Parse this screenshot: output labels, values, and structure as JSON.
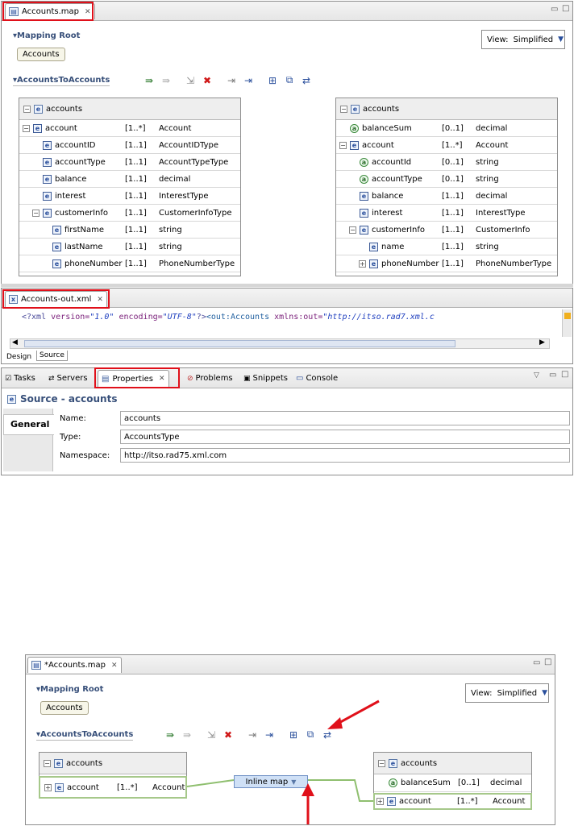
{
  "top_editor": {
    "tab_title": "Accounts.map",
    "mapping_root_label": "Mapping Root",
    "root_pill": "Accounts",
    "view_label": "View:",
    "view_value": "Simplified",
    "map_section": "AccountsToAccounts",
    "source": {
      "header": "accounts",
      "rows": [
        {
          "name": "account",
          "card": "[1..*]",
          "type": "Account",
          "indent": 0,
          "exp": "−",
          "icon": "e"
        },
        {
          "name": "accountID",
          "card": "[1..1]",
          "type": "AccountIDType",
          "indent": 1,
          "exp": "",
          "icon": "e"
        },
        {
          "name": "accountType",
          "card": "[1..1]",
          "type": "AccountTypeType",
          "indent": 1,
          "exp": "",
          "icon": "e"
        },
        {
          "name": "balance",
          "card": "[1..1]",
          "type": "decimal",
          "indent": 1,
          "exp": "",
          "icon": "e"
        },
        {
          "name": "interest",
          "card": "[1..1]",
          "type": "InterestType",
          "indent": 1,
          "exp": "",
          "icon": "e"
        },
        {
          "name": "customerInfo",
          "card": "[1..1]",
          "type": "CustomerInfoType",
          "indent": 1,
          "exp": "−",
          "icon": "e"
        },
        {
          "name": "firstName",
          "card": "[1..1]",
          "type": "string",
          "indent": 2,
          "exp": "",
          "icon": "e"
        },
        {
          "name": "lastName",
          "card": "[1..1]",
          "type": "string",
          "indent": 2,
          "exp": "",
          "icon": "e"
        },
        {
          "name": "phoneNumber",
          "card": "[1..1]",
          "type": "PhoneNumberType",
          "indent": 2,
          "exp": "",
          "icon": "e"
        }
      ]
    },
    "target": {
      "header": "accounts",
      "rows": [
        {
          "name": "balanceSum",
          "card": "[0..1]",
          "type": "decimal",
          "indent": 0,
          "exp": "",
          "icon": "a"
        },
        {
          "name": "account",
          "card": "[1..*]",
          "type": "Account",
          "indent": 0,
          "exp": "−",
          "icon": "e"
        },
        {
          "name": "accountId",
          "card": "[0..1]",
          "type": "string",
          "indent": 1,
          "exp": "",
          "icon": "a"
        },
        {
          "name": "accountType",
          "card": "[0..1]",
          "type": "string",
          "indent": 1,
          "exp": "",
          "icon": "a"
        },
        {
          "name": "balance",
          "card": "[1..1]",
          "type": "decimal",
          "indent": 1,
          "exp": "",
          "icon": "e"
        },
        {
          "name": "interest",
          "card": "[1..1]",
          "type": "InterestType",
          "indent": 1,
          "exp": "",
          "icon": "e"
        },
        {
          "name": "customerInfo",
          "card": "[1..1]",
          "type": "CustomerInfo",
          "indent": 1,
          "exp": "−",
          "icon": "e"
        },
        {
          "name": "name",
          "card": "[1..1]",
          "type": "string",
          "indent": 2,
          "exp": "",
          "icon": "e"
        },
        {
          "name": "phoneNumber",
          "card": "[1..1]",
          "type": "PhoneNumberType",
          "indent": 2,
          "exp": "+",
          "icon": "e"
        }
      ]
    }
  },
  "xml_editor": {
    "tab_title": "Accounts-out.xml",
    "decl_open": "<?xml",
    "version_attr": "version=",
    "version_val": "\"1.0\"",
    "enc_attr": "encoding=",
    "enc_val": "\"UTF-8\"",
    "decl_close": "?>",
    "elem": "<out:Accounts",
    "ns_attr": "xmlns:out=",
    "ns_val": "\"http://itso.rad7.xml.c",
    "tab_design": "Design",
    "tab_source": "Source"
  },
  "bottom_panel": {
    "tabs": [
      "Tasks",
      "Servers",
      "Properties",
      "Problems",
      "Snippets",
      "Console"
    ],
    "title": "Source - accounts",
    "side_tab": "General",
    "fields": [
      {
        "label": "Name:",
        "value": "accounts"
      },
      {
        "label": "Type:",
        "value": "AccountsType"
      },
      {
        "label": "Namespace:",
        "value": "http://itso.rad75.xml.com"
      }
    ]
  },
  "lower_editor": {
    "tab_title": "*Accounts.map",
    "mapping_root_label": "Mapping Root",
    "root_pill": "Accounts",
    "view_label": "View:",
    "view_value": "Simplified",
    "map_section": "AccountsToAccounts",
    "source": {
      "header": "accounts",
      "row": {
        "name": "account",
        "card": "[1..*]",
        "type": "Account"
      }
    },
    "inline_map": "Inline map",
    "target": {
      "header": "accounts",
      "rows": [
        {
          "name": "balanceSum",
          "card": "[0..1]",
          "type": "decimal",
          "icon": "a",
          "exp": ""
        },
        {
          "name": "account",
          "card": "[1..*]",
          "type": "Account",
          "icon": "e",
          "exp": "+"
        }
      ]
    }
  },
  "colors": {
    "highlight": "#e0101a",
    "mapping_green": "#8fbf6f",
    "header": "#38507a"
  }
}
